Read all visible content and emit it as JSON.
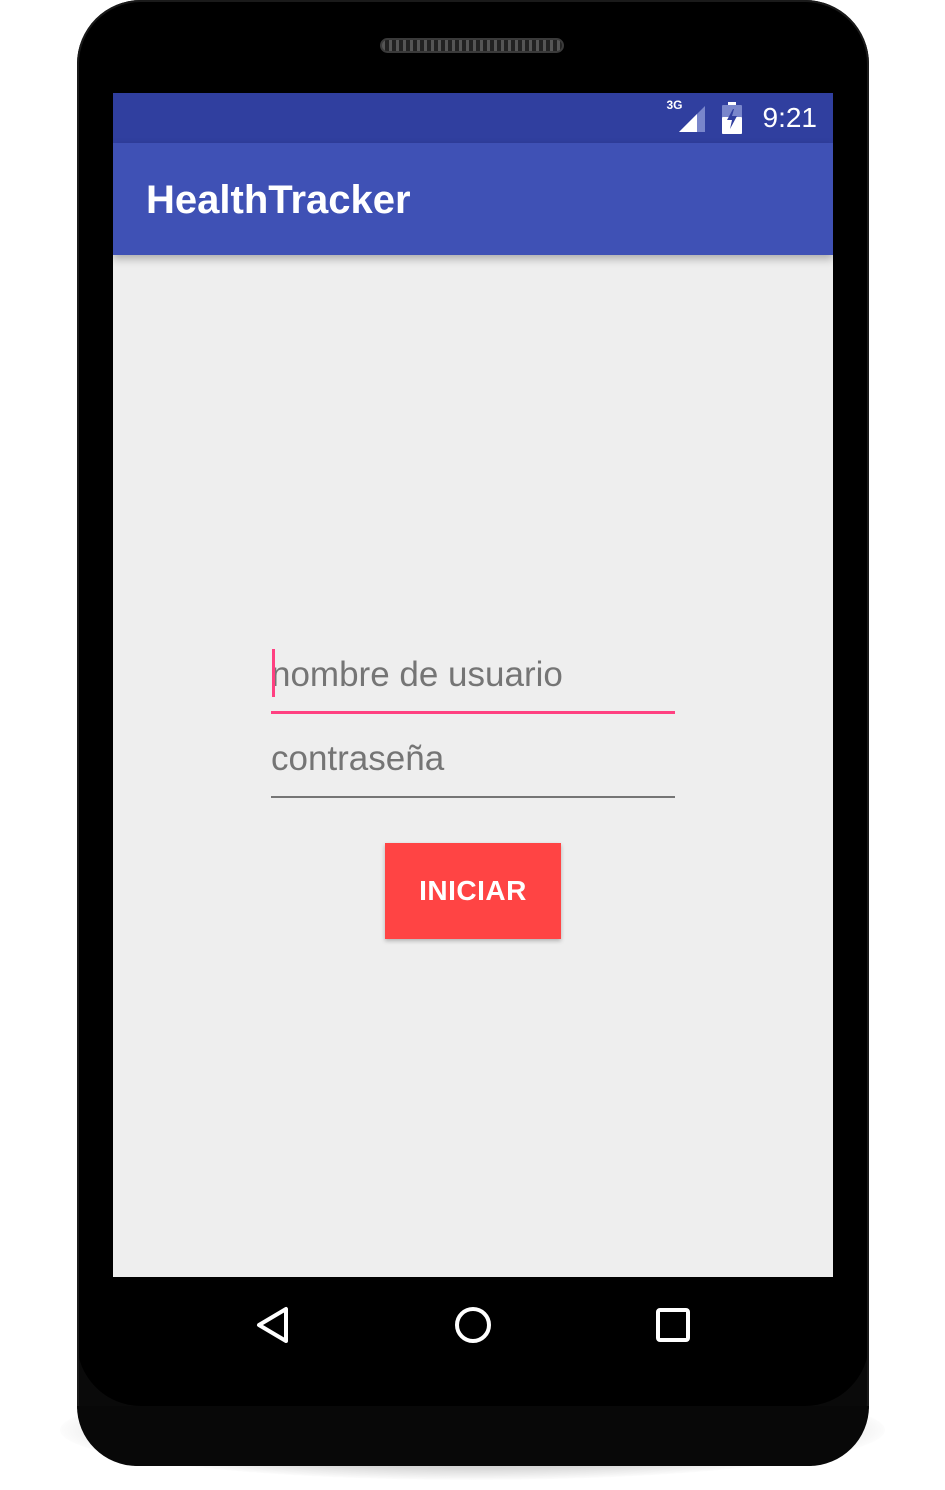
{
  "status_bar": {
    "network_label": "3G",
    "time": "9:21",
    "icons": [
      "signal-icon",
      "battery-charging-icon"
    ]
  },
  "app_bar": {
    "title": "HealthTracker"
  },
  "login_form": {
    "username_placeholder": "nombre de usuario",
    "username_value": "",
    "password_placeholder": "contraseña",
    "password_value": "",
    "submit_label": "INICIAR"
  },
  "nav_bar": {
    "icons": [
      "back-icon",
      "home-icon",
      "recents-icon"
    ]
  },
  "colors": {
    "status_bar": "#303f9f",
    "primary": "#3f51b5",
    "accent": "#ff4081",
    "button": "#ff4444",
    "background": "#eeeeee"
  }
}
